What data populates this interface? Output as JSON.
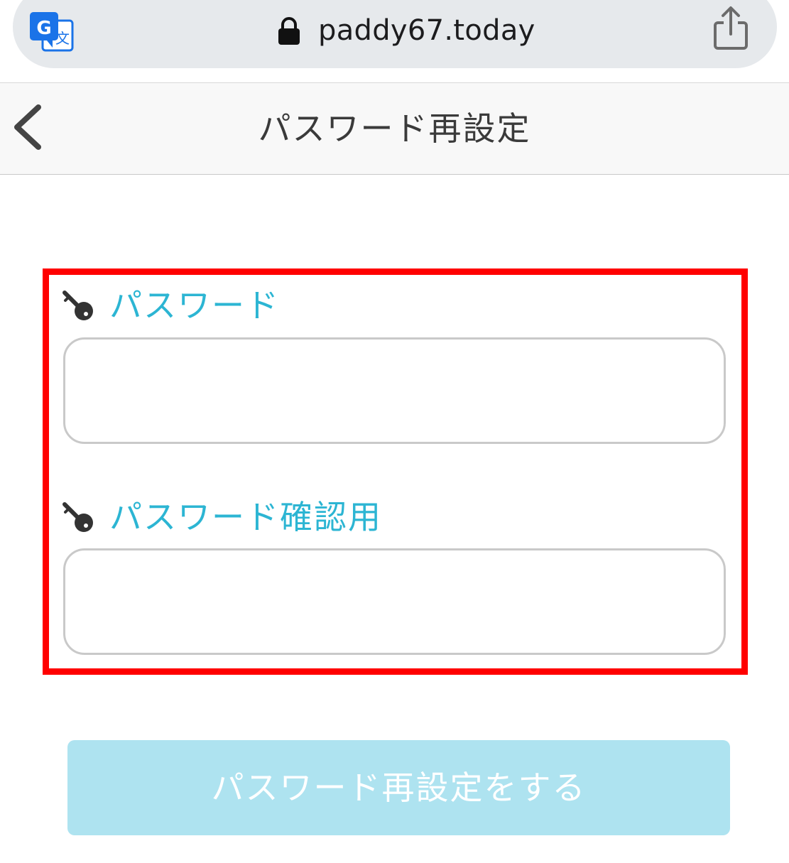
{
  "browser": {
    "url": "paddy67.today"
  },
  "header": {
    "title": "パスワード再設定"
  },
  "form": {
    "password_label": "パスワード",
    "password_value": "",
    "confirm_label": "パスワード確認用",
    "confirm_value": ""
  },
  "submit": {
    "label": "パスワード再設定をする"
  },
  "colors": {
    "accent": "#2cb5d3",
    "button_bg": "#aee3f0",
    "highlight": "#ff0000"
  },
  "icons": {
    "translate": "translate-icon",
    "lock": "lock-icon",
    "share": "share-icon",
    "back": "chevron-left-icon",
    "key": "key-icon"
  }
}
